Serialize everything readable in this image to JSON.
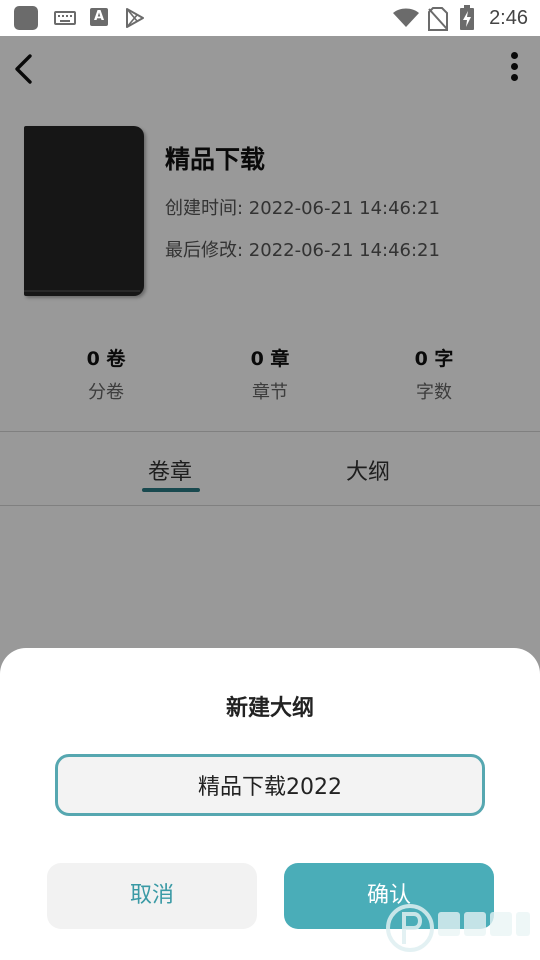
{
  "status_bar": {
    "time": "2:46",
    "notification_icons": [
      "app-icon",
      "keyboard-icon",
      "a-icon",
      "play-store-icon"
    ],
    "system_icons": [
      "wifi-icon",
      "no-sim-icon",
      "battery-charging-icon"
    ]
  },
  "toolbar": {
    "back_icon": "back-arrow-icon",
    "more_icon": "more-vertical-icon"
  },
  "book": {
    "title": "精品下载",
    "created": "创建时间: 2022-06-21 14:46:21",
    "modified": "最后修改: 2022-06-21 14:46:21"
  },
  "stats": [
    {
      "value": "0 卷",
      "label": "分卷"
    },
    {
      "value": "0 章",
      "label": "章节"
    },
    {
      "value": "0 字",
      "label": "字数"
    }
  ],
  "tabs": [
    {
      "label": "卷章",
      "active": true
    },
    {
      "label": "大纲",
      "active": false
    }
  ],
  "dialog": {
    "title": "新建大纲",
    "input_value": "精品下载2022",
    "cancel_label": "取消",
    "confirm_label": "确认"
  },
  "colors": {
    "accent": "#4aadb8",
    "accent_dark": "#2a7b84",
    "input_border": "#56a7b0"
  }
}
